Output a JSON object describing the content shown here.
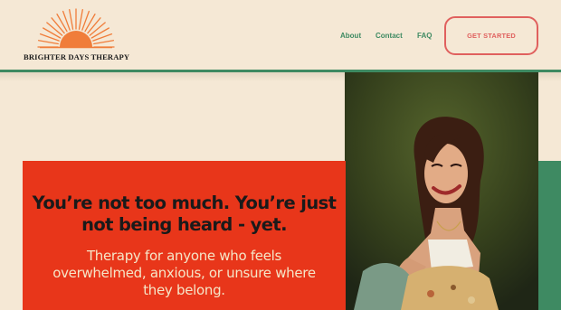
{
  "brand": {
    "name": "BRIGHTER DAYS THERAPY"
  },
  "nav": {
    "about": "About",
    "contact": "Contact",
    "faq": "FAQ",
    "cta": "GET STARTED"
  },
  "hero": {
    "title": "You’re not too much. You’re just not being heard - yet.",
    "subtitle": "Therapy for anyone who feels overwhelmed, anxious, or unsure where they belong."
  },
  "colors": {
    "background": "#f5e8d5",
    "accent_green": "#3e8a62",
    "hero_red": "#e8361a",
    "cta_coral": "#e0605e",
    "sun_orange": "#f07d3a"
  },
  "icons": {
    "logo": "sunrise-icon"
  }
}
